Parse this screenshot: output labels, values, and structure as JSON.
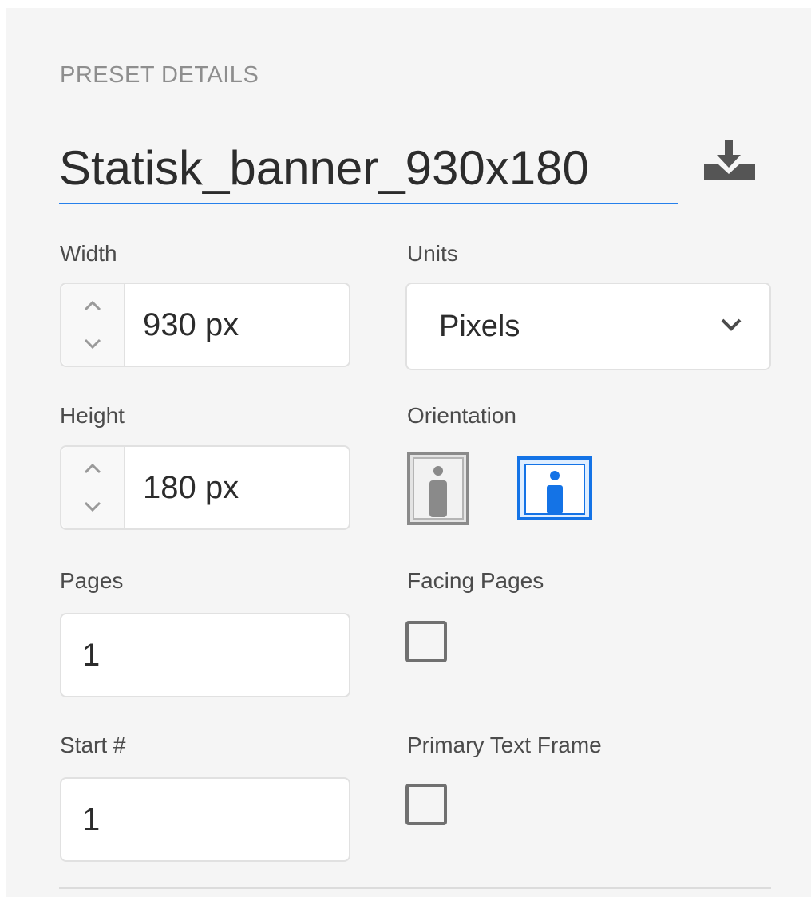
{
  "section_title": "PRESET DETAILS",
  "preset_name": "Statisk_banner_930x180",
  "width": {
    "label": "Width",
    "value": "930 px"
  },
  "height": {
    "label": "Height",
    "value": "180 px"
  },
  "units": {
    "label": "Units",
    "selected": "Pixels"
  },
  "orientation": {
    "label": "Orientation",
    "selected": "landscape"
  },
  "pages": {
    "label": "Pages",
    "value": "1"
  },
  "facing_pages": {
    "label": "Facing Pages",
    "checked": false
  },
  "start_number": {
    "label": "Start #",
    "value": "1"
  },
  "primary_text_frame": {
    "label": "Primary Text Frame",
    "checked": false
  },
  "colors": {
    "accent": "#2680eb",
    "panel_bg": "#f5f5f5",
    "label": "#4b4b4b"
  }
}
